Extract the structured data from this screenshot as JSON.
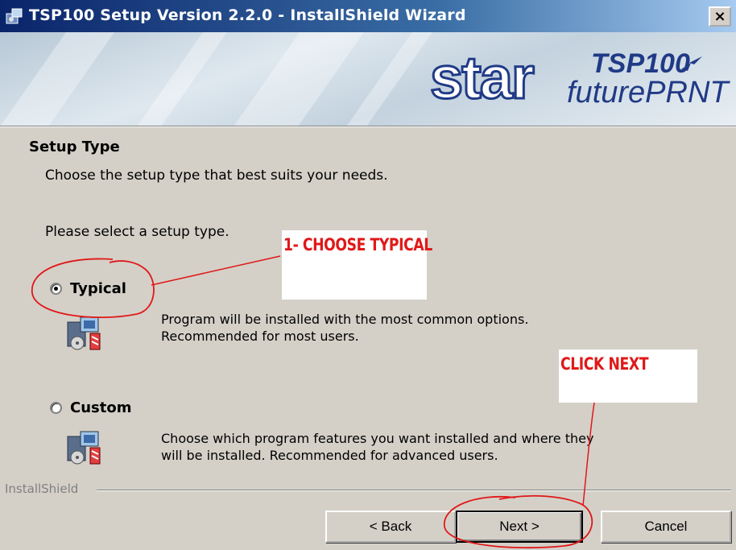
{
  "window": {
    "title": "TSP100 Setup Version 2.2.0 - InstallShield Wizard",
    "close_label": "×"
  },
  "banner": {
    "logo_brand": "star",
    "logo_model": "TSP100",
    "logo_product": "futurePRNT"
  },
  "page": {
    "heading": "Setup Type",
    "subheading": "Choose the setup type that best suits your needs.",
    "prompt": "Please select a setup type."
  },
  "options": [
    {
      "label": "Typical",
      "checked": true,
      "description_line1": "Program will be installed with the most common options.",
      "description_line2": "Recommended for most users."
    },
    {
      "label": "Custom",
      "checked": false,
      "description_line1": "Choose which program features you want installed and where they",
      "description_line2": "will be installed. Recommended for advanced users."
    }
  ],
  "footer": {
    "brand_label": "InstallShield",
    "back_label": "< Back",
    "next_label": "Next >",
    "cancel_label": "Cancel"
  },
  "annotations": {
    "step1": "1- CHOOSE TYPICAL",
    "step2": "CLICK NEXT",
    "color": "#e01818"
  }
}
